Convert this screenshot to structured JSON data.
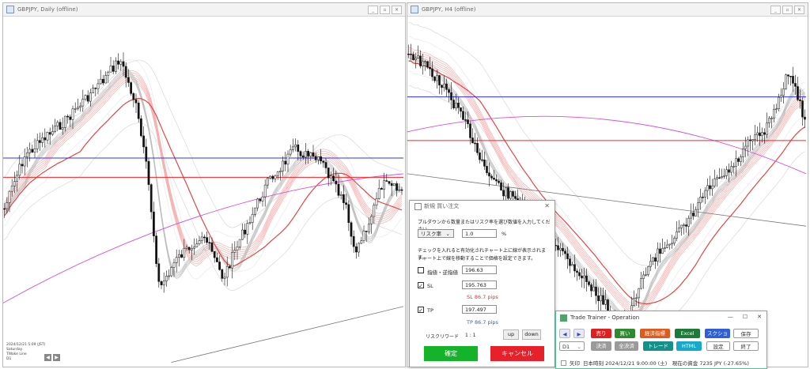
{
  "left_window": {
    "title": "GBPJPY, Daily (offline)",
    "info": [
      "2024/12/21 5:09 (JST)",
      "Saturday",
      "TWake Line",
      "D1"
    ],
    "nav": [
      "◀",
      "▶"
    ]
  },
  "right_window": {
    "title": "GBPJPY, H4 (offline)"
  },
  "window_controls": [
    "_",
    "▫",
    "✕"
  ],
  "order_dialog": {
    "title": "新規 買い注文",
    "close": "✕",
    "instruction": "プルダウンから数量またはリスク率を選び数値を入力してください。",
    "risk_select": "リスク率",
    "risk_value": "1.0",
    "risk_unit": "%",
    "note1": "チェックを入れると有効化されチャート上に線が表示されます。",
    "note2": "チャート上で線を移動することで価格を設定できます。",
    "limit_label": "指値・逆指値",
    "limit_value": "196.63",
    "sl_label": "SL",
    "sl_value": "195.763",
    "sl_pips": "SL 86.7 pips",
    "tp_label": "TP",
    "tp_value": "197.497",
    "tp_pips": "TP 86.7 pips",
    "reward_label": "リスクリワード",
    "reward_value": "1 : 1",
    "up": "up",
    "down": "down",
    "confirm": "確定",
    "cancel": "キャンセル"
  },
  "trade_trainer": {
    "title": "Trade Trainer - Operation",
    "controls": [
      "—",
      "☐",
      "✕"
    ],
    "arrow_left": "◀",
    "arrow_right": "▶",
    "sell": "売り",
    "buy": "買い",
    "economic": "経済指標",
    "excel": "Excel",
    "screenshot": "スクショ",
    "save": "保存",
    "timeframe": "D1",
    "settle": "決済",
    "settle_all": "全決済",
    "trade": "トレード",
    "html": "HTML",
    "settings": "設定",
    "exit": "終了",
    "arrow_label": "矢印",
    "status": "日本時刻 2024/12/21 9:00:00 (土)　現在の資金 7235 JPY (-27.65%)"
  },
  "colors": {
    "sell": "#e02020",
    "buy": "#2f8a2f",
    "economic": "#e05a1c",
    "excel": "#1f7a3a",
    "screenshot": "#2e5fd6",
    "trade": "#17908a",
    "html": "#17a9c9",
    "gray_btn": "#9a9a9a",
    "confirm": "#15b32a",
    "cancel": "#e8202a",
    "sl_text": "#e03030",
    "tp_text": "#2f5fd8",
    "blue_line": "#3030ff",
    "red_line": "#ff2020"
  }
}
